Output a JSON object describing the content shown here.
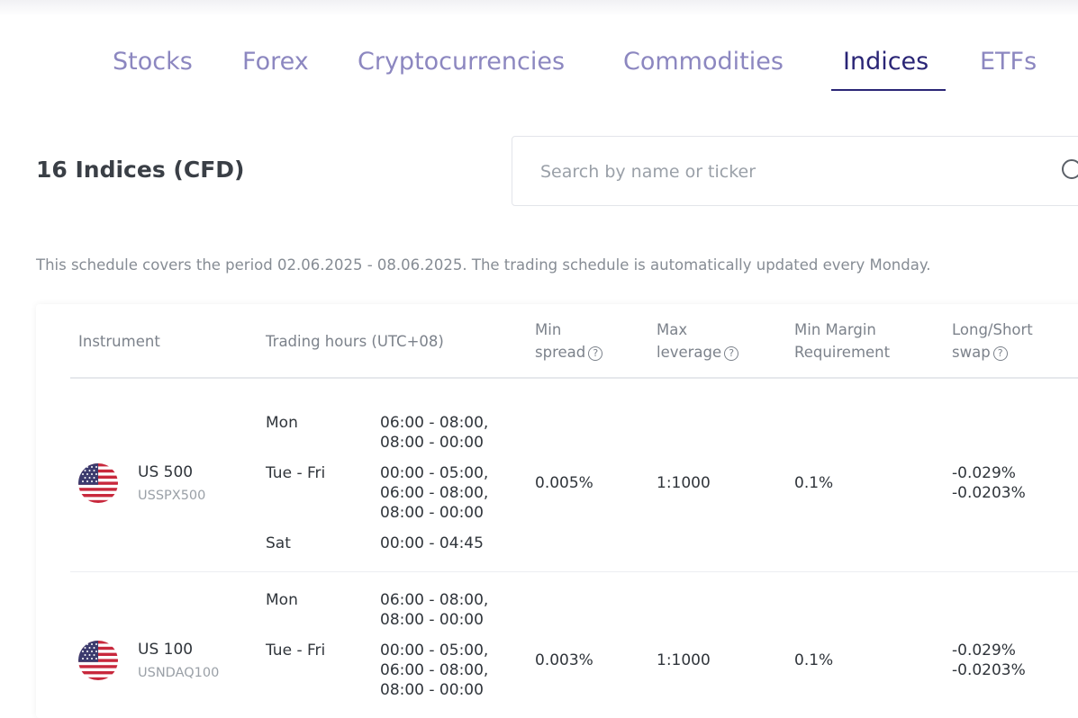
{
  "tabs": [
    {
      "label": "Stocks",
      "active": false
    },
    {
      "label": "Forex",
      "active": false
    },
    {
      "label": "Cryptocurrencies",
      "active": false
    },
    {
      "label": "Commodities",
      "active": false
    },
    {
      "label": "Indices",
      "active": true
    },
    {
      "label": "ETFs",
      "active": false
    }
  ],
  "heading": "16 Indices (CFD)",
  "search": {
    "placeholder": "Search by name or ticker"
  },
  "schedule_note": "This schedule covers the period 02.06.2025 - 08.06.2025. The trading schedule is automatically updated every Monday.",
  "table": {
    "headers": {
      "instrument": "Instrument",
      "trading_hours": "Trading hours (UTC+08)",
      "min_spread": [
        "Min",
        "spread"
      ],
      "max_leverage": [
        "Max",
        "leverage"
      ],
      "min_margin": [
        "Min Margin",
        "Requirement"
      ],
      "swap": [
        "Long/Short",
        "swap"
      ],
      "help_glyph": "?"
    },
    "rows": [
      {
        "name": "US 500",
        "ticker": "USSPX500",
        "hours": [
          {
            "day": "Mon",
            "times": [
              "06:00 - 08:00,",
              "08:00 - 00:00"
            ]
          },
          {
            "day": "Tue - Fri",
            "times": [
              "00:00 - 05:00,",
              "06:00 - 08:00,",
              "08:00 - 00:00"
            ]
          },
          {
            "day": "Sat",
            "times": [
              "00:00 - 04:45"
            ]
          }
        ],
        "min_spread": "0.005%",
        "max_leverage": "1:1000",
        "min_margin": "0.1%",
        "swap_long": "-0.029%",
        "swap_short": "-0.0203%"
      },
      {
        "name": "US 100",
        "ticker": "USNDAQ100",
        "hours": [
          {
            "day": "Mon",
            "times": [
              "06:00 - 08:00,",
              "08:00 - 00:00"
            ]
          },
          {
            "day": "Tue - Fri",
            "times": [
              "00:00 - 05:00,",
              "06:00 - 08:00,",
              "08:00 - 00:00"
            ]
          }
        ],
        "min_spread": "0.003%",
        "max_leverage": "1:1000",
        "min_margin": "0.1%",
        "swap_long": "-0.029%",
        "swap_short": "-0.0203%"
      }
    ]
  },
  "colors": {
    "tab_inactive": "#8c87c0",
    "tab_active": "#2a2576",
    "flag_red": "#c8283c",
    "flag_blue": "#3c3b6e"
  }
}
